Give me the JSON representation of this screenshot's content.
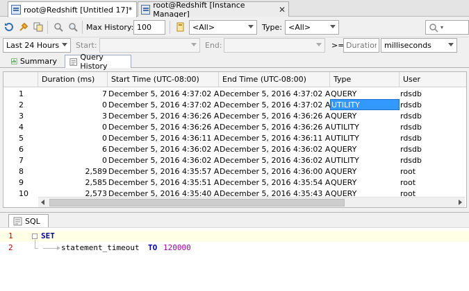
{
  "editor_tabs": [
    {
      "label": "root@Redshift [Untitled 17]*",
      "active": true
    },
    {
      "label": "root@Redshift [Instance Manager]",
      "active": false
    }
  ],
  "toolbar": {
    "max_history_label": "Max History:",
    "max_history_value": "100",
    "connection_value": "<All>",
    "type_label": "Type:",
    "type_value": "<All>"
  },
  "filter": {
    "range_value": "Last 24 Hours",
    "start_label": "Start:",
    "end_label": "End:",
    "ge_label": ">=",
    "duration_placeholder": "Duration",
    "unit_value": "milliseconds"
  },
  "subtabs": [
    {
      "label": "Summary",
      "active": false
    },
    {
      "label": "Query History",
      "active": true
    }
  ],
  "grid": {
    "columns": [
      "Duration (ms)",
      "Start Time (UTC-08:00)",
      "End Time (UTC-08:00)",
      "Type",
      "User"
    ],
    "rows": [
      {
        "n": "1",
        "duration": "7",
        "start": "December 5, 2016 4:37:02 A...",
        "end": "December 5, 2016 4:37:02 A...",
        "type": "QUERY",
        "user": "rdsdb"
      },
      {
        "n": "2",
        "duration": "0",
        "start": "December 5, 2016 4:37:02 A...",
        "end": "December 5, 2016 4:37:02 A...",
        "type": "UTILITY",
        "user": "rdsdb"
      },
      {
        "n": "3",
        "duration": "3",
        "start": "December 5, 2016 4:36:26 A...",
        "end": "December 5, 2016 4:36:26 A...",
        "type": "QUERY",
        "user": "rdsdb"
      },
      {
        "n": "4",
        "duration": "0",
        "start": "December 5, 2016 4:36:26 A...",
        "end": "December 5, 2016 4:36:26 A...",
        "type": "UTILITY",
        "user": "rdsdb"
      },
      {
        "n": "5",
        "duration": "0",
        "start": "December 5, 2016 4:36:11 A...",
        "end": "December 5, 2016 4:36:11 A...",
        "type": "UTILITY",
        "user": "rdsdb"
      },
      {
        "n": "6",
        "duration": "6",
        "start": "December 5, 2016 4:36:02 A...",
        "end": "December 5, 2016 4:36:02 A...",
        "type": "QUERY",
        "user": "rdsdb"
      },
      {
        "n": "7",
        "duration": "0",
        "start": "December 5, 2016 4:36:02 A...",
        "end": "December 5, 2016 4:36:02 A...",
        "type": "UTILITY",
        "user": "rdsdb"
      },
      {
        "n": "8",
        "duration": "2,589",
        "start": "December 5, 2016 4:35:57 A...",
        "end": "December 5, 2016 4:36:00 A...",
        "type": "QUERY",
        "user": "root"
      },
      {
        "n": "9",
        "duration": "2,585",
        "start": "December 5, 2016 4:35:51 A...",
        "end": "December 5, 2016 4:35:54 A...",
        "type": "QUERY",
        "user": "root"
      },
      {
        "n": "10",
        "duration": "2,573",
        "start": "December 5, 2016 4:35:40 A...",
        "end": "December 5, 2016 4:35:43 A...",
        "type": "QUERY",
        "user": "root"
      }
    ]
  },
  "sql": {
    "tab_label": "SQL",
    "lines": [
      {
        "n": "1",
        "kw": "SET",
        "text": "",
        "kw2": "",
        "num": ""
      },
      {
        "n": "2",
        "kw": "",
        "text": "statement_timeout",
        "kw2": "TO",
        "num": "120000"
      }
    ]
  },
  "colors": {
    "selection": "#3399ff",
    "keyword": "#0000a0",
    "number": "#a000a0",
    "line_number": "#c00000",
    "current_line": "#ffffe6"
  }
}
